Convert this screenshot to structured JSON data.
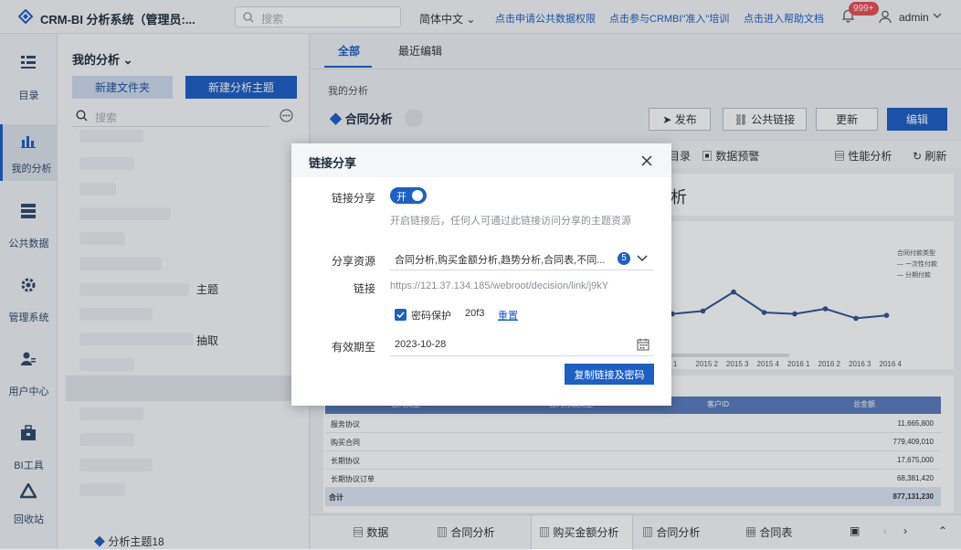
{
  "app": {
    "title": "CRM-BI 分析系统（管理员:...",
    "search_placeholder": "搜索",
    "language": "简体中文",
    "links": [
      "点击申请公共数据权限",
      "点击参与CRMBI\"准入\"培训",
      "点击进入帮助文档"
    ],
    "notification_count": "999+",
    "username": "admin"
  },
  "nav": [
    {
      "label": "目录",
      "icon": "catalog-icon"
    },
    {
      "label": "我的分析",
      "icon": "bar-chart-icon",
      "active": true
    },
    {
      "label": "公共数据",
      "icon": "database-icon"
    },
    {
      "label": "管理系统",
      "icon": "gear-icon"
    },
    {
      "label": "用户中心",
      "icon": "user-manage-icon"
    },
    {
      "label": "BI工具",
      "icon": "toolbox-icon"
    },
    {
      "label": "回收站",
      "icon": "recycle-icon"
    }
  ],
  "sidebar": {
    "title": "我的分析",
    "new_folder": "新建文件夹",
    "new_topic": "新建分析主题",
    "search_placeholder": "搜索",
    "visible_fragments": [
      "主题",
      "抽取"
    ],
    "bottom_item": "分析主题18"
  },
  "main": {
    "tabs": [
      "全部",
      "最近编辑"
    ],
    "breadcrumb": "我的分析",
    "topic_title": "合同分析",
    "actions": {
      "publish": "发布",
      "public_link": "公共链接",
      "update": "更新",
      "edit": "编辑"
    },
    "toolbar": [
      "目录",
      "数据预警",
      "性能分析",
      "刷新"
    ],
    "card_title_frag": "析",
    "chart_legend": {
      "title": "合同付款类型",
      "items": [
        "一次性付款",
        "分期付款"
      ]
    },
    "table": {
      "header": [
        "合同类型",
        "合同付款类型",
        "客户ID",
        "总金额"
      ],
      "rows": [
        [
          "服务协议",
          "11,665,800"
        ],
        [
          "购买合同",
          "779,409,010"
        ],
        [
          "长期协议",
          "17,675,000"
        ],
        [
          "长期协议订单",
          "68,381,420"
        ]
      ],
      "total_label": "合计",
      "total_value": "877,131,230"
    },
    "bottom_tabs": [
      "数据",
      "合同分析",
      "购买金额分析",
      "合同分析",
      "合同表"
    ]
  },
  "chart_data": {
    "type": "line",
    "categories": [
      ".5 1",
      "2015 2",
      "2015 3",
      "2015 4",
      "2016 1",
      "2016 2",
      "2016 3",
      "2016 4"
    ],
    "series": [
      {
        "name": "分期付款",
        "values": [
          0.48,
          0.52,
          0.78,
          0.5,
          0.48,
          0.55,
          0.42,
          0.46
        ]
      }
    ],
    "legend_title": "合同付款类型"
  },
  "modal": {
    "title": "链接分享",
    "labels": {
      "share": "链接分享",
      "resource": "分享资源",
      "link": "链接",
      "expiry": "有效期至"
    },
    "toggle_text": "开",
    "hint": "开启链接后，任何人可通过此链接访问分享的主题资源",
    "resources_text": "合同分析,购买金额分析,趋势分析,合同表,不同...",
    "resources_count": "5",
    "url": "https://121.37.134.185/webroot/decision/link/j9kY",
    "password_label": "密码保护",
    "password": "20f3",
    "reset": "重置",
    "expiry_date": "2023-10-28",
    "copy_button": "复制链接及密码"
  }
}
